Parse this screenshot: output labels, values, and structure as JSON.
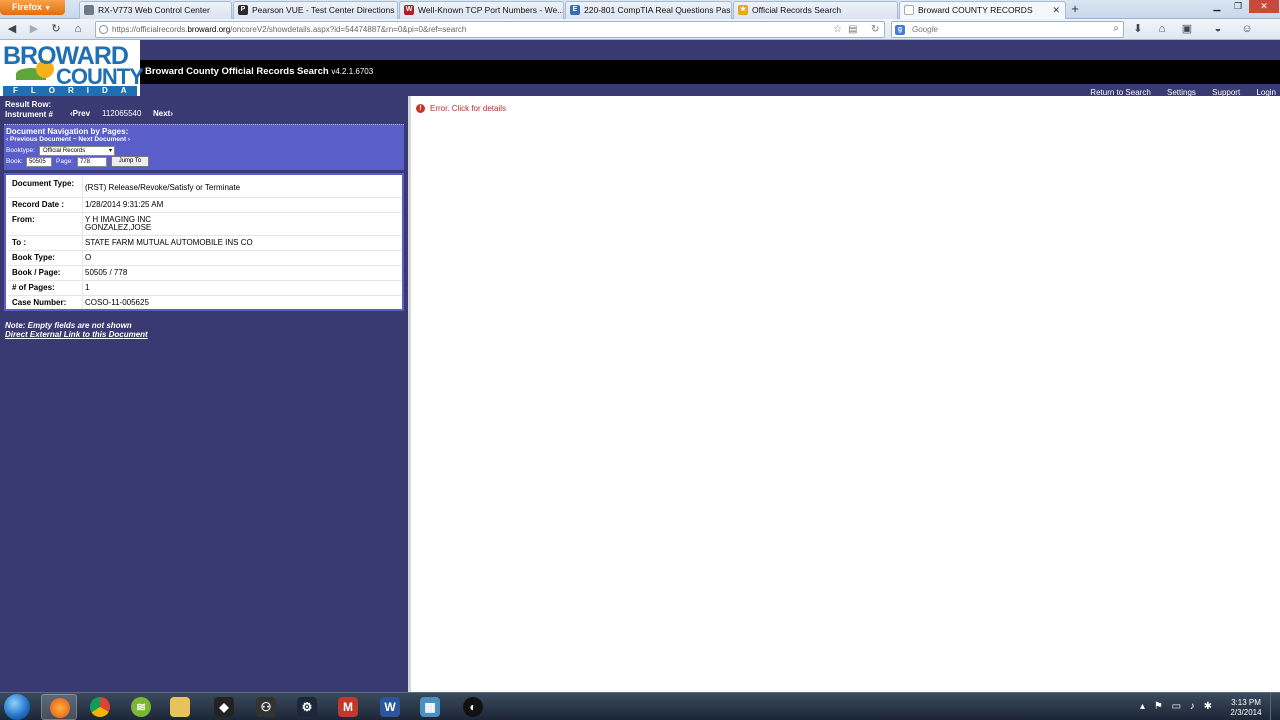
{
  "browser": {
    "menu_label": "Firefox",
    "tabs": [
      {
        "label": "RX-V773 Web Control Center",
        "icon": "page-icon",
        "color": "#6d7a8c"
      },
      {
        "label": "Pearson VUE - Test Center Directions",
        "icon": "P",
        "color": "#2b2b2b"
      },
      {
        "label": "Well-Known TCP Port Numbers - We...",
        "icon": "W",
        "color": "#b01e2e"
      },
      {
        "label": "220-801 CompTIA Real Questions Pas...",
        "icon": "E",
        "color": "#3a6db0"
      },
      {
        "label": "Official Records Search",
        "icon": "star",
        "color": "#e6a817"
      },
      {
        "label": "Broward COUNTY RECORDS",
        "icon": "page-icon",
        "color": "#ffffff",
        "active": true
      }
    ],
    "new_tab_label": "+",
    "url_prefix": "https://officialrecords.",
    "url_domain": "broward.org",
    "url_suffix": "/oncoreV2/showdetails.aspx?id=54474887&rn=0&pi=0&ref=search",
    "search_placeholder": "Google"
  },
  "header": {
    "logo_line1": "BROWARD",
    "logo_line2": "COUNTY",
    "logo_line3": "FLORIDA",
    "app_title": "Broward County Official Records Search",
    "app_version": "v4.2.1.6703",
    "links": [
      "Return to Search",
      "Settings",
      "Support",
      "Login"
    ]
  },
  "result_nav": {
    "result_row_label": "Result Row:",
    "instrument_label": "Instrument #",
    "prev_label": "Prev",
    "instrument_number": "112065540",
    "next_label": "Next"
  },
  "doc_nav": {
    "title": "Document Navigation by Pages:",
    "links_text": "Previous Document  ~  Next Document",
    "booktype_label": "Booktype:",
    "booktype_value": "Official Records",
    "book_label": "Book:",
    "book_value": "50505",
    "page_label": "Page:",
    "page_value": "778",
    "jump_label": "Jump To"
  },
  "details": [
    {
      "label": "Document Type:",
      "value": "(RST) Release/Revoke/Satisfy or Terminate"
    },
    {
      "label": "Record Date :",
      "value": "1/28/2014 9:31:25 AM"
    },
    {
      "label": "From:",
      "value": "Y H IMAGING INC\nGONZALEZ,JOSE"
    },
    {
      "label": "To :",
      "value": "STATE FARM MUTUAL AUTOMOBILE INS CO"
    },
    {
      "label": "Book Type:",
      "value": "O"
    },
    {
      "label": "Book / Page:",
      "value": "50505 / 778"
    },
    {
      "label": "# of Pages:",
      "value": "1"
    },
    {
      "label": "Case Number:",
      "value": "COSO-11-005625"
    }
  ],
  "footer_notes": {
    "note": "Note: Empty fields are not shown",
    "external_link": "Direct External Link to this Document"
  },
  "viewer": {
    "error_text": "Error. Click for details"
  },
  "taskbar": {
    "apps": [
      "firefox-icon",
      "chrome-icon",
      "spotify-icon",
      "explorer-icon",
      "fox-app-icon",
      "gaming-icon",
      "steam-icon",
      "m-app-icon",
      "word-icon",
      "remote-desktop-icon",
      "media-icon"
    ],
    "time": "3:13 PM",
    "date": "2/3/2014"
  }
}
